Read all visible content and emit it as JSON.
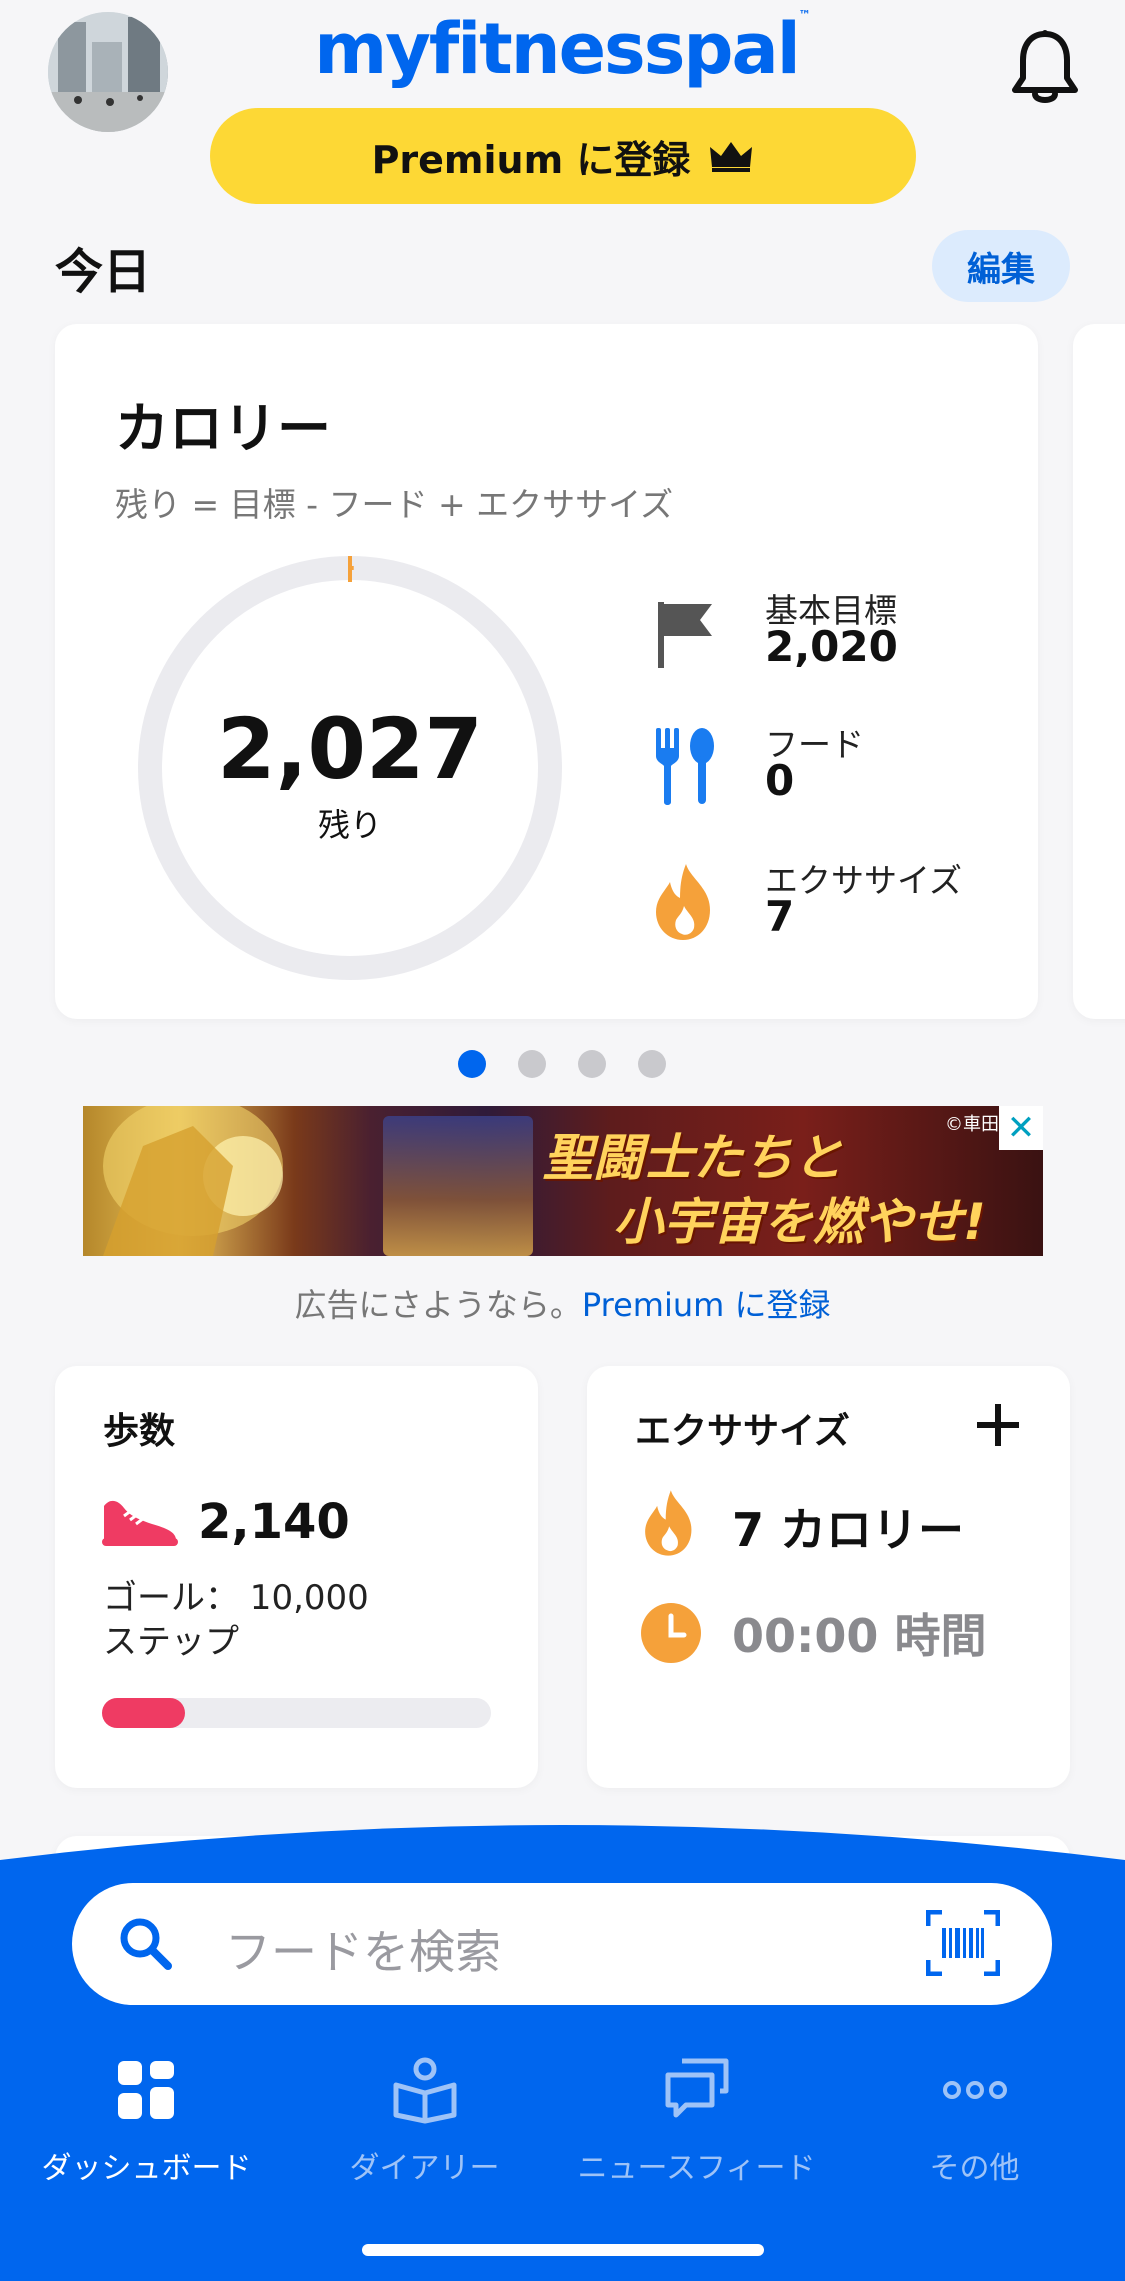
{
  "header": {
    "logo": "myfitnesspal",
    "logo_tm": "™",
    "premium_button": "Premium に登録"
  },
  "today": {
    "title": "今日",
    "edit": "編集"
  },
  "calories": {
    "title": "カロリー",
    "formula": "残り = 目標 - フード + エクササイズ",
    "remaining": "2,027",
    "remaining_label": "残り",
    "remaining_fraction": 0.997,
    "base_goal_label": "基本目標",
    "base_goal": "2,020",
    "food_label": "フード",
    "food": "0",
    "exercise_label": "エクササイズ",
    "exercise": "7"
  },
  "carousel": {
    "pages": 4,
    "active": 0
  },
  "ad": {
    "headline_1": "聖闘士たちと",
    "headline_2": "小宇宙を燃やせ!",
    "copyright": "©車田",
    "caption": "広告にさようなら。",
    "caption_link": "Premium に登録"
  },
  "steps": {
    "title": "歩数",
    "value": "2,140",
    "goal_line_1": "ゴール： 10,000",
    "goal_line_2": "ステップ",
    "progress": 0.214
  },
  "exercise_card": {
    "title": "エクササイズ",
    "calories": "7 カロリー",
    "time": "00:00 時間"
  },
  "search": {
    "placeholder": "フードを検索"
  },
  "nav": [
    {
      "label": "ダッシュボード",
      "icon": "dashboard-icon",
      "active": true
    },
    {
      "label": "ダイアリー",
      "icon": "diary-icon",
      "active": false
    },
    {
      "label": "ニュースフィード",
      "icon": "newsfeed-icon",
      "active": false
    },
    {
      "label": "その他",
      "icon": "more-icon",
      "active": false
    }
  ],
  "colors": {
    "brand_blue": "#0066ee",
    "premium_yellow": "#fdd835",
    "steps_red": "#ef3b63",
    "exercise_orange": "#f5a13a"
  }
}
